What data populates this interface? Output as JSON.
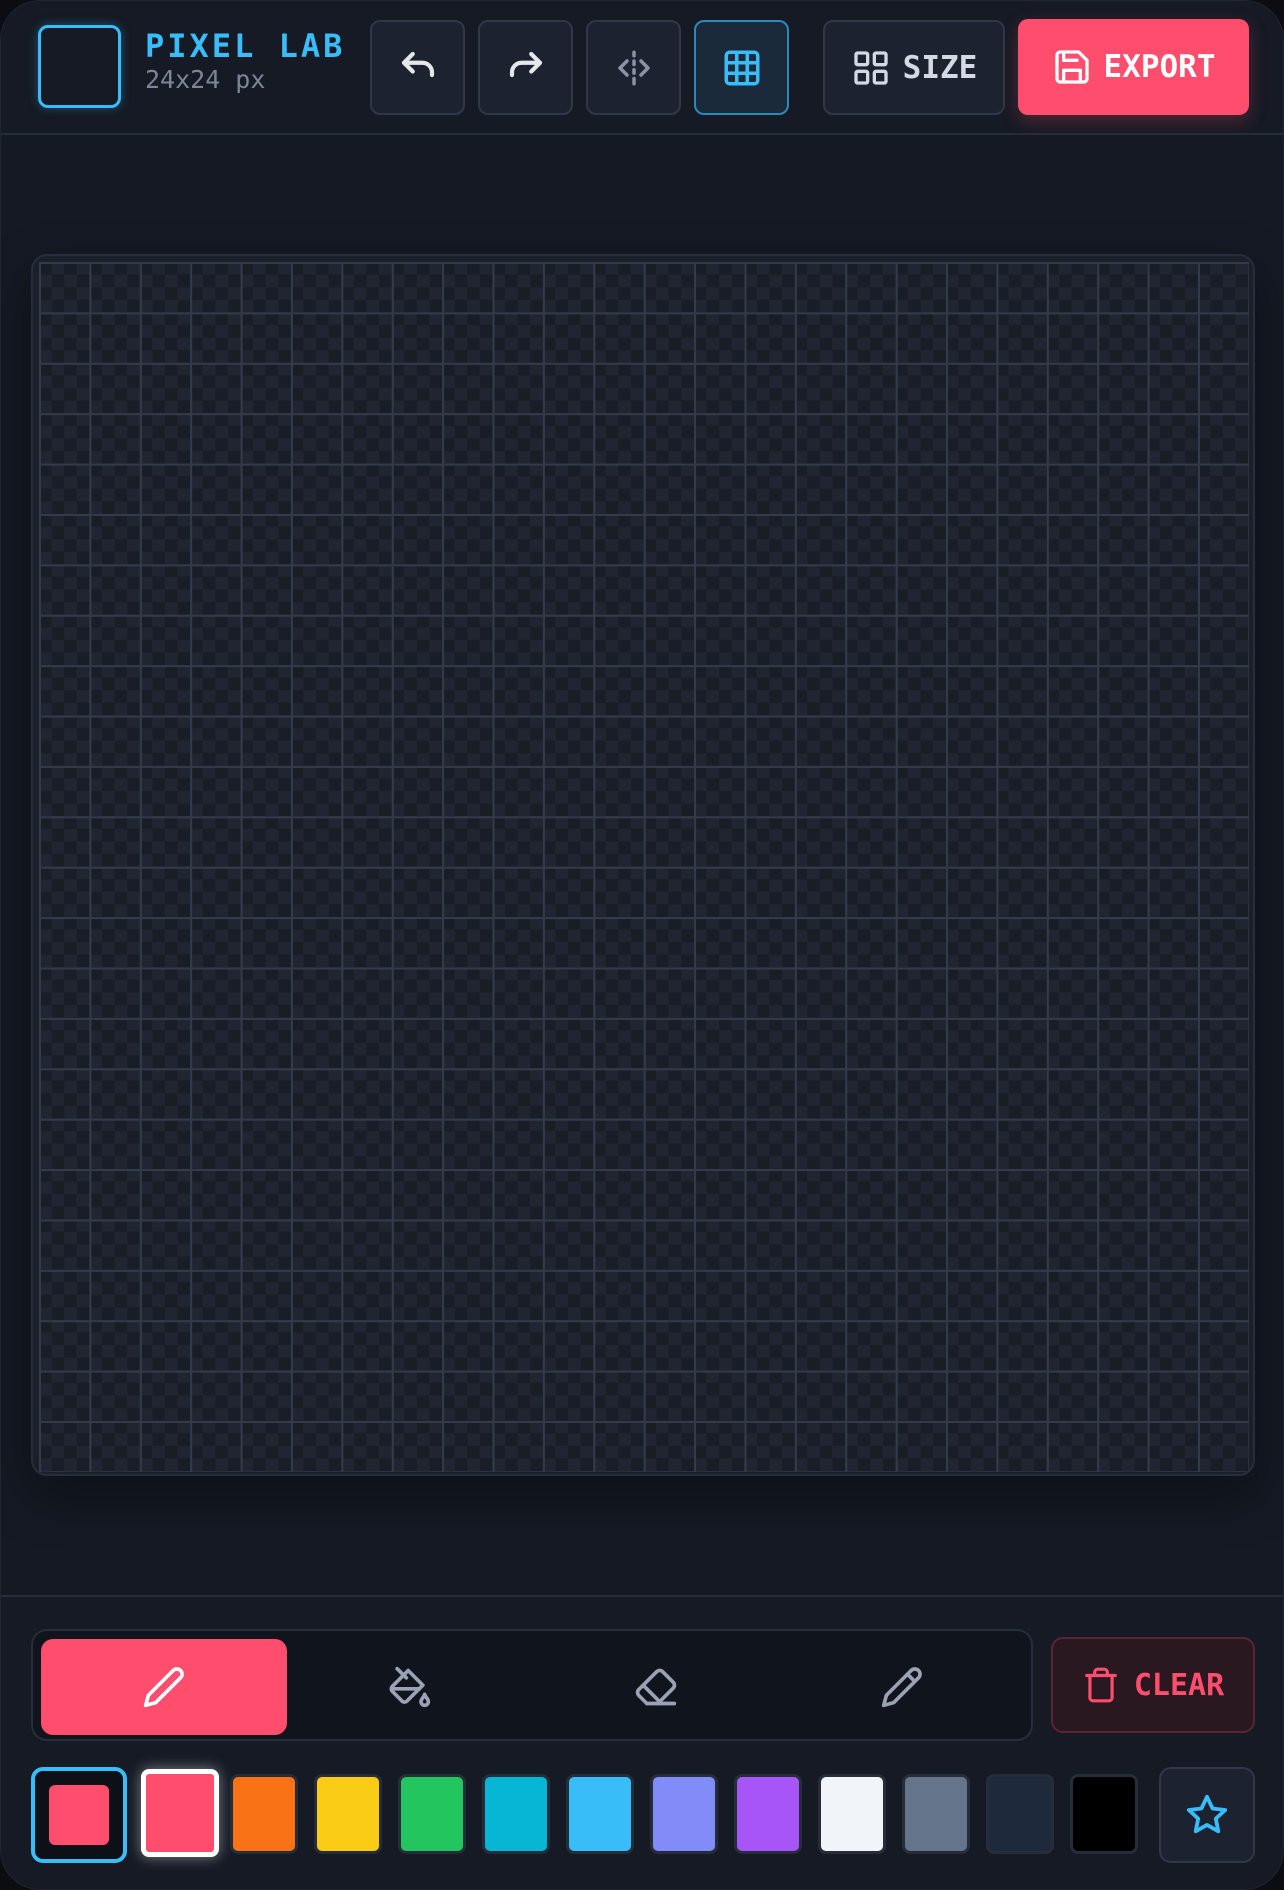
{
  "header": {
    "title": "PIXEL LAB",
    "subtitle": "24x24 px",
    "size_label": "SIZE",
    "export_label": "EXPORT",
    "tools": [
      {
        "name": "undo-icon",
        "active": false
      },
      {
        "name": "redo-icon",
        "active": false
      },
      {
        "name": "mirror-icon",
        "active": false
      },
      {
        "name": "grid-icon",
        "active": true
      }
    ]
  },
  "canvas": {
    "columns": 24,
    "rows": 24
  },
  "bottom": {
    "draw_tools": [
      {
        "name": "pencil-icon",
        "active": true
      },
      {
        "name": "fill-bucket-icon",
        "active": false
      },
      {
        "name": "eraser-icon",
        "active": false
      },
      {
        "name": "eyedropper-icon",
        "active": false
      }
    ],
    "clear_label": "CLEAR",
    "current_color": "#ff4d6d",
    "palette": [
      {
        "color": "#ff4d6d",
        "selected": true
      },
      {
        "color": "#f97316",
        "selected": false
      },
      {
        "color": "#facc15",
        "selected": false
      },
      {
        "color": "#22c55e",
        "selected": false
      },
      {
        "color": "#06b6d4",
        "selected": false
      },
      {
        "color": "#38bdf8",
        "selected": false
      },
      {
        "color": "#818cf8",
        "selected": false
      },
      {
        "color": "#a855f7",
        "selected": false
      },
      {
        "color": "#f1f5f9",
        "selected": false
      },
      {
        "color": "#64748b",
        "selected": false
      },
      {
        "color": "#1e293b",
        "selected": false
      },
      {
        "color": "#000000",
        "selected": false
      }
    ],
    "favorite_icon": "star-icon"
  },
  "colors": {
    "accent": "#38bdf8",
    "brand": "#ff4d6d",
    "background": "#151a24"
  }
}
